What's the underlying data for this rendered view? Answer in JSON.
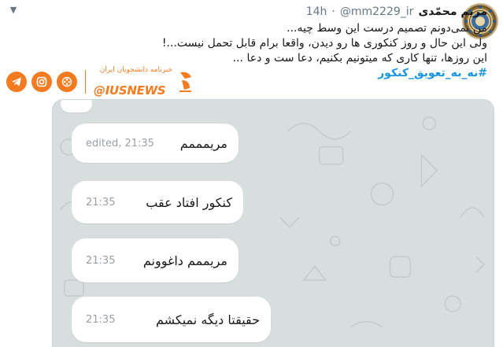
{
  "tweet": {
    "author_name": "مریم محمّدی",
    "handle": "@mm2229_ir",
    "separator": "·",
    "time": "14h",
    "caret_icon": "chevron-down-icon",
    "text_lines": [
      "من نمی‌دونم تصمیم درست این وسط چیه...",
      "ولی این حال و روز کنکوری ها رو دیدن، واقعا برام قابل تحمل نیست...!",
      "این روزها، تنها کاری که میتونیم بکنیم، دعا ست و دعا ..."
    ],
    "hashtag": "#نه_به_تعویق_کنکور"
  },
  "watermark": {
    "tagline": "خبرنامه دانشجویان ایران",
    "name": "@IUSNEWS",
    "icons": [
      "telegram-icon",
      "instagram-icon",
      "aparat-icon"
    ],
    "accent_color": "#f47b20"
  },
  "chat": {
    "messages": [
      {
        "text": "مریمممم",
        "meta": "edited, 21:35"
      },
      {
        "text": "کنکور افتاد عقب",
        "meta": "21:35"
      },
      {
        "text": "مریممم داغوونم",
        "meta": "21:35"
      },
      {
        "text": "حقیقتا دیگه نمیکشم",
        "meta": "21:35"
      }
    ]
  }
}
